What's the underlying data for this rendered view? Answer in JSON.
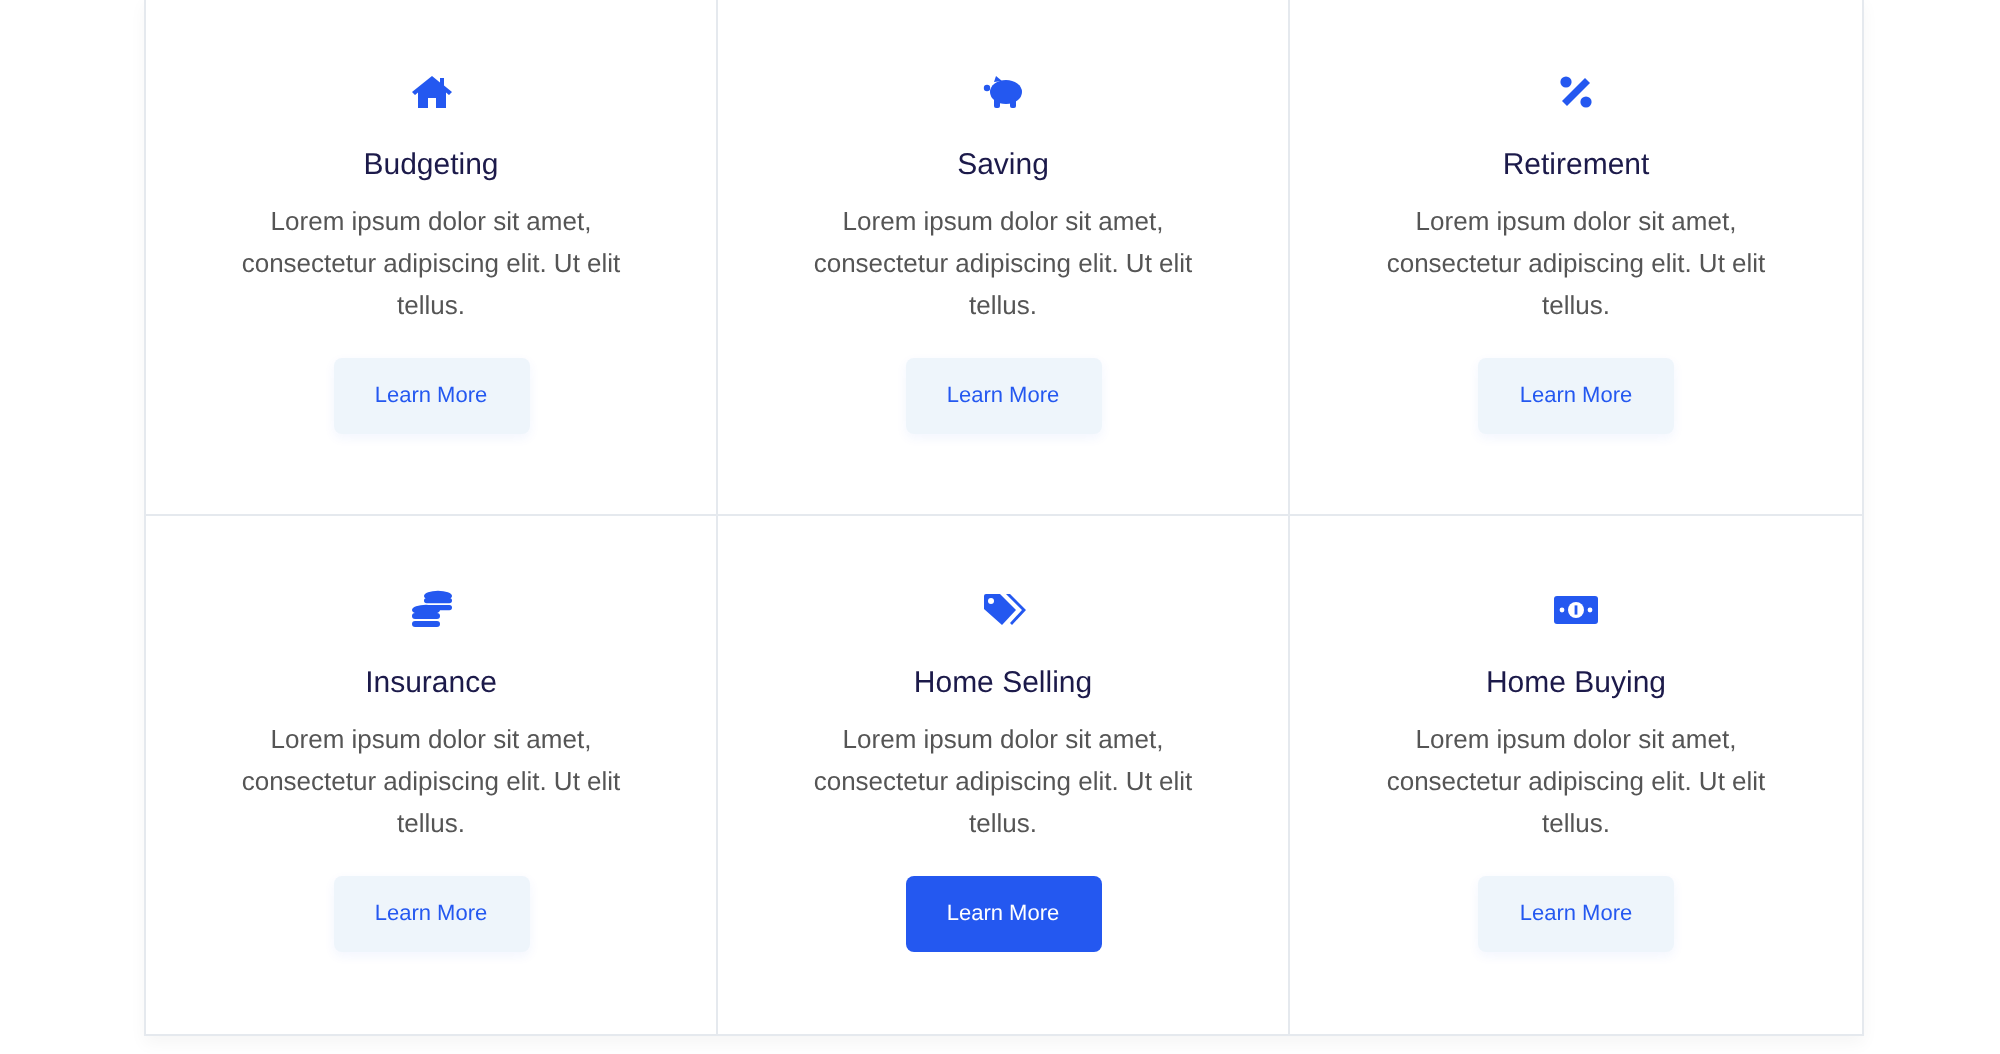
{
  "cards": [
    {
      "kind": "house",
      "title": "Budgeting",
      "text": "Lorem ipsum dolor sit amet, consectetur adipiscing elit. Ut elit tellus.",
      "button": {
        "label": "Learn More",
        "highlighted": false
      }
    },
    {
      "kind": "piggy",
      "title": "Saving",
      "text": "Lorem ipsum dolor sit amet, consectetur adipiscing elit. Ut elit tellus.",
      "button": {
        "label": "Learn More",
        "highlighted": false
      }
    },
    {
      "kind": "percent",
      "title": "Retirement",
      "text": "Lorem ipsum dolor sit amet, consectetur adipiscing elit. Ut elit tellus.",
      "button": {
        "label": "Learn More",
        "highlighted": false
      }
    },
    {
      "kind": "coins",
      "title": "Insurance",
      "text": "Lorem ipsum dolor sit amet, consectetur adipiscing elit. Ut elit tellus.",
      "button": {
        "label": "Learn More",
        "highlighted": false
      }
    },
    {
      "kind": "tags",
      "title": "Home Selling",
      "text": "Lorem ipsum dolor sit amet, consectetur adipiscing elit. Ut elit tellus.",
      "button": {
        "label": "Learn More",
        "highlighted": true
      }
    },
    {
      "kind": "money",
      "title": "Home Buying",
      "text": "Lorem ipsum dolor sit amet, consectetur adipiscing elit. Ut elit tellus.",
      "button": {
        "label": "Learn More",
        "highlighted": false
      }
    }
  ]
}
